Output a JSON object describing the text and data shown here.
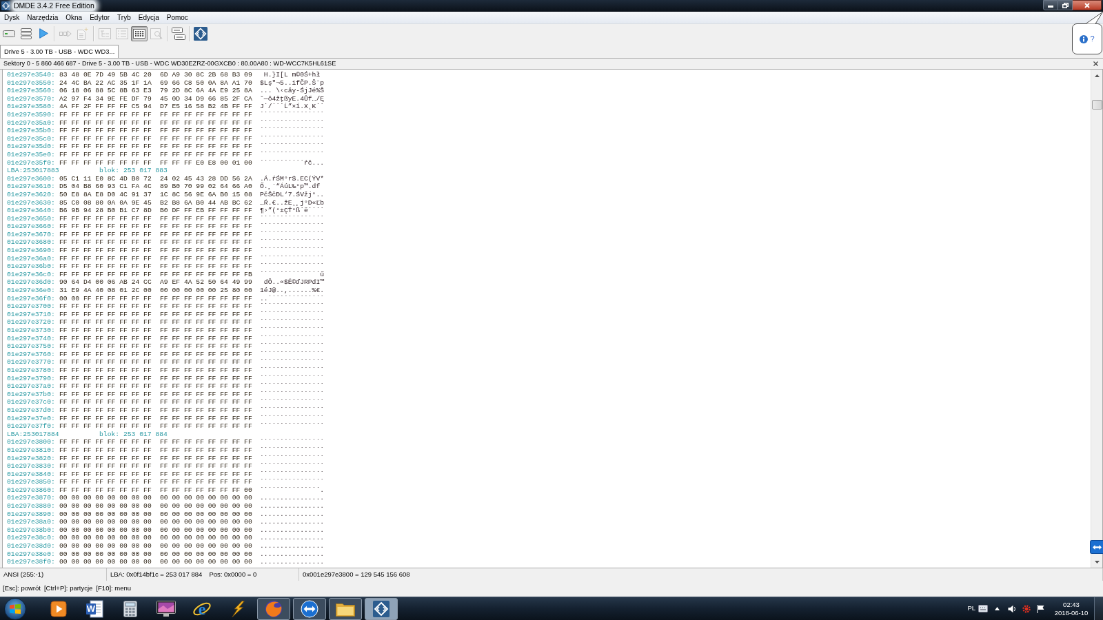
{
  "window": {
    "title": "DMDE 3.4.2 Free Edition"
  },
  "menu": [
    "Dysk",
    "Narzędzia",
    "Okna",
    "Edytor",
    "Tryb",
    "Edycja",
    "Pomoc"
  ],
  "toolbar": [
    [
      {
        "disabled": false,
        "pressed": false
      },
      {
        "disabled": false,
        "pressed": false
      },
      {
        "disabled": false,
        "pressed": false
      }
    ],
    [
      {
        "disabled": true,
        "pressed": false
      },
      {
        "disabled": true,
        "pressed": false
      }
    ],
    [
      {
        "disabled": true,
        "pressed": false
      },
      {
        "disabled": true,
        "pressed": false
      },
      {
        "disabled": false,
        "pressed": true
      },
      {
        "disabled": true,
        "pressed": false
      }
    ],
    [
      {
        "disabled": false,
        "pressed": false
      }
    ],
    [
      {
        "disabled": false,
        "pressed": false
      }
    ]
  ],
  "help": {
    "label": "?"
  },
  "tabs": [
    {
      "label": "Drive 5 - 3.00 TB - USB - WDC WD3...",
      "selected": true
    }
  ],
  "panel": {
    "title": "Sektory 0 - 5 860 466 687 - Drive 5 - 3.00 TB - USB - WDC WD30EZRZ-00GXCB0 : 80.00A80 : WD-WCC7K5HL61SE"
  },
  "hex_view": {
    "lines": [
      {
        "kind": "data",
        "offset": "01e297e3540:",
        "bytes": [
          "83 48 0E 7D 49 5B 4C 20",
          "6D A9 30 8C 2B 68 B3 09"
        ],
        "text": " H.}I[L m©0Ś+hł"
      },
      {
        "kind": "data",
        "offset": "01e297e3550:",
        "bytes": [
          "24 4C BA 22 AC 35 1F 1A",
          "69 66 C8 50 0A 8A A1 70"
        ],
        "text": "$Lş\"¬5..ifČP.Šˇp"
      },
      {
        "kind": "data",
        "offset": "01e297e3560:",
        "bytes": [
          "06 18 06 88 5C 8B 63 E3",
          "79 2D 8C 6A 4A E9 25 8A"
        ],
        "text": "... \\‹căy-ŚjJé%Š"
      },
      {
        "kind": "data",
        "offset": "01e297e3570:",
        "bytes": [
          "A2 97 F4 34 9E FE DF 79",
          "45 0D 34 D9 66 85 2F CA"
        ],
        "text": "˘—ô4žţßyE.4Ůf…/Ę"
      },
      {
        "kind": "data",
        "offset": "01e297e3580:",
        "bytes": [
          "4A FF 2F FF FF FF C5 94",
          "D7 E5 16 58 B2 4B FF FF"
        ],
        "text": "J˙/˙˙˙Ĺ”×ĺ.X˛K˙˙"
      },
      {
        "kind": "data",
        "offset": "01e297e3590:",
        "bytes": [
          "FF FF FF FF FF FF FF FF",
          "FF FF FF FF FF FF FF FF"
        ],
        "text": "˙˙˙˙˙˙˙˙˙˙˙˙˙˙˙˙"
      },
      {
        "kind": "data",
        "offset": "01e297e35a0:",
        "bytes": [
          "FF FF FF FF FF FF FF FF",
          "FF FF FF FF FF FF FF FF"
        ],
        "text": "˙˙˙˙˙˙˙˙˙˙˙˙˙˙˙˙"
      },
      {
        "kind": "data",
        "offset": "01e297e35b0:",
        "bytes": [
          "FF FF FF FF FF FF FF FF",
          "FF FF FF FF FF FF FF FF"
        ],
        "text": "˙˙˙˙˙˙˙˙˙˙˙˙˙˙˙˙"
      },
      {
        "kind": "data",
        "offset": "01e297e35c0:",
        "bytes": [
          "FF FF FF FF FF FF FF FF",
          "FF FF FF FF FF FF FF FF"
        ],
        "text": "˙˙˙˙˙˙˙˙˙˙˙˙˙˙˙˙"
      },
      {
        "kind": "data",
        "offset": "01e297e35d0:",
        "bytes": [
          "FF FF FF FF FF FF FF FF",
          "FF FF FF FF FF FF FF FF"
        ],
        "text": "˙˙˙˙˙˙˙˙˙˙˙˙˙˙˙˙"
      },
      {
        "kind": "data",
        "offset": "01e297e35e0:",
        "bytes": [
          "FF FF FF FF FF FF FF FF",
          "FF FF FF FF FF FF FF FF"
        ],
        "text": "˙˙˙˙˙˙˙˙˙˙˙˙˙˙˙˙"
      },
      {
        "kind": "data",
        "offset": "01e297e35f0:",
        "bytes": [
          "FF FF FF FF FF FF FF FF",
          "FF FF FF E0 E8 00 01 00"
        ],
        "text": "˙˙˙˙˙˙˙˙˙˙˙ŕč..."
      },
      {
        "kind": "sector",
        "lba": "LBA:253017883",
        "block": "blok: 253 017 883"
      },
      {
        "kind": "data",
        "offset": "01e297e3600:",
        "bytes": [
          "05 C1 11 E0 8C 4D B0 72",
          "24 02 45 43 28 DD 56 2A"
        ],
        "text": ".Á.ŕŚM°r$.EC(ÝV*"
      },
      {
        "kind": "data",
        "offset": "01e297e3610:",
        "bytes": [
          "D5 04 B8 60 93 C1 FA 4C",
          "89 B0 70 99 02 64 66 A0"
        ],
        "text": "Ő.¸`“ÁúL‰°p™.df"
      },
      {
        "kind": "data",
        "offset": "01e297e3620:",
        "bytes": [
          "50 E8 8A E8 D0 4C 91 37",
          "1C 8C 56 9E 6A B0 15 08"
        ],
        "text": "PčŠčĐL‘7.ŚVžj°.."
      },
      {
        "kind": "data",
        "offset": "01e297e3630:",
        "bytes": [
          "85 C0 08 80 0A 0A 9E 45",
          "B2 B8 6A B0 44 AB BC 62"
        ],
        "text": "…Ŕ.€..žE˛¸j°D«Ľb"
      },
      {
        "kind": "data",
        "offset": "01e297e3640:",
        "bytes": [
          "B6 9B 94 28 B0 B1 C7 8D",
          "B0 DF FF EB FF FF FF FF"
        ],
        "text": "¶›”(°±ÇŤ°ß˙ë˙˙˙˙"
      },
      {
        "kind": "data",
        "offset": "01e297e3650:",
        "bytes": [
          "FF FF FF FF FF FF FF FF",
          "FF FF FF FF FF FF FF FF"
        ],
        "text": "˙˙˙˙˙˙˙˙˙˙˙˙˙˙˙˙"
      },
      {
        "kind": "data",
        "offset": "01e297e3660:",
        "bytes": [
          "FF FF FF FF FF FF FF FF",
          "FF FF FF FF FF FF FF FF"
        ],
        "text": "˙˙˙˙˙˙˙˙˙˙˙˙˙˙˙˙"
      },
      {
        "kind": "data",
        "offset": "01e297e3670:",
        "bytes": [
          "FF FF FF FF FF FF FF FF",
          "FF FF FF FF FF FF FF FF"
        ],
        "text": "˙˙˙˙˙˙˙˙˙˙˙˙˙˙˙˙"
      },
      {
        "kind": "data",
        "offset": "01e297e3680:",
        "bytes": [
          "FF FF FF FF FF FF FF FF",
          "FF FF FF FF FF FF FF FF"
        ],
        "text": "˙˙˙˙˙˙˙˙˙˙˙˙˙˙˙˙"
      },
      {
        "kind": "data",
        "offset": "01e297e3690:",
        "bytes": [
          "FF FF FF FF FF FF FF FF",
          "FF FF FF FF FF FF FF FF"
        ],
        "text": "˙˙˙˙˙˙˙˙˙˙˙˙˙˙˙˙"
      },
      {
        "kind": "data",
        "offset": "01e297e36a0:",
        "bytes": [
          "FF FF FF FF FF FF FF FF",
          "FF FF FF FF FF FF FF FF"
        ],
        "text": "˙˙˙˙˙˙˙˙˙˙˙˙˙˙˙˙"
      },
      {
        "kind": "data",
        "offset": "01e297e36b0:",
        "bytes": [
          "FF FF FF FF FF FF FF FF",
          "FF FF FF FF FF FF FF FF"
        ],
        "text": "˙˙˙˙˙˙˙˙˙˙˙˙˙˙˙˙"
      },
      {
        "kind": "data",
        "offset": "01e297e36c0:",
        "bytes": [
          "FF FF FF FF FF FF FF FF",
          "FF FF FF FF FF FF FF FB"
        ],
        "text": "˙˙˙˙˙˙˙˙˙˙˙˙˙˙˙ű"
      },
      {
        "kind": "data",
        "offset": "01e297e36d0:",
        "bytes": [
          "90 64 D4 00 06 AB 24 CC",
          "A9 EF 4A 52 50 64 49 99"
        ],
        "text": " dÔ..«$Ě©ďJRPdI™"
      },
      {
        "kind": "data",
        "offset": "01e297e36e0:",
        "bytes": [
          "31 E9 4A 40 08 01 2C 00",
          "00 00 00 00 00 25 80 00"
        ],
        "text": "1éJ@..,......%€."
      },
      {
        "kind": "data",
        "offset": "01e297e36f0:",
        "bytes": [
          "00 00 FF FF FF FF FF FF",
          "FF FF FF FF FF FF FF FF"
        ],
        "text": "..˙˙˙˙˙˙˙˙˙˙˙˙˙˙"
      },
      {
        "kind": "data",
        "offset": "01e297e3700:",
        "bytes": [
          "FF FF FF FF FF FF FF FF",
          "FF FF FF FF FF FF FF FF"
        ],
        "text": "˙˙˙˙˙˙˙˙˙˙˙˙˙˙˙˙"
      },
      {
        "kind": "data",
        "offset": "01e297e3710:",
        "bytes": [
          "FF FF FF FF FF FF FF FF",
          "FF FF FF FF FF FF FF FF"
        ],
        "text": "˙˙˙˙˙˙˙˙˙˙˙˙˙˙˙˙"
      },
      {
        "kind": "data",
        "offset": "01e297e3720:",
        "bytes": [
          "FF FF FF FF FF FF FF FF",
          "FF FF FF FF FF FF FF FF"
        ],
        "text": "˙˙˙˙˙˙˙˙˙˙˙˙˙˙˙˙"
      },
      {
        "kind": "data",
        "offset": "01e297e3730:",
        "bytes": [
          "FF FF FF FF FF FF FF FF",
          "FF FF FF FF FF FF FF FF"
        ],
        "text": "˙˙˙˙˙˙˙˙˙˙˙˙˙˙˙˙"
      },
      {
        "kind": "data",
        "offset": "01e297e3740:",
        "bytes": [
          "FF FF FF FF FF FF FF FF",
          "FF FF FF FF FF FF FF FF"
        ],
        "text": "˙˙˙˙˙˙˙˙˙˙˙˙˙˙˙˙"
      },
      {
        "kind": "data",
        "offset": "01e297e3750:",
        "bytes": [
          "FF FF FF FF FF FF FF FF",
          "FF FF FF FF FF FF FF FF"
        ],
        "text": "˙˙˙˙˙˙˙˙˙˙˙˙˙˙˙˙"
      },
      {
        "kind": "data",
        "offset": "01e297e3760:",
        "bytes": [
          "FF FF FF FF FF FF FF FF",
          "FF FF FF FF FF FF FF FF"
        ],
        "text": "˙˙˙˙˙˙˙˙˙˙˙˙˙˙˙˙"
      },
      {
        "kind": "data",
        "offset": "01e297e3770:",
        "bytes": [
          "FF FF FF FF FF FF FF FF",
          "FF FF FF FF FF FF FF FF"
        ],
        "text": "˙˙˙˙˙˙˙˙˙˙˙˙˙˙˙˙"
      },
      {
        "kind": "data",
        "offset": "01e297e3780:",
        "bytes": [
          "FF FF FF FF FF FF FF FF",
          "FF FF FF FF FF FF FF FF"
        ],
        "text": "˙˙˙˙˙˙˙˙˙˙˙˙˙˙˙˙"
      },
      {
        "kind": "data",
        "offset": "01e297e3790:",
        "bytes": [
          "FF FF FF FF FF FF FF FF",
          "FF FF FF FF FF FF FF FF"
        ],
        "text": "˙˙˙˙˙˙˙˙˙˙˙˙˙˙˙˙"
      },
      {
        "kind": "data",
        "offset": "01e297e37a0:",
        "bytes": [
          "FF FF FF FF FF FF FF FF",
          "FF FF FF FF FF FF FF FF"
        ],
        "text": "˙˙˙˙˙˙˙˙˙˙˙˙˙˙˙˙"
      },
      {
        "kind": "data",
        "offset": "01e297e37b0:",
        "bytes": [
          "FF FF FF FF FF FF FF FF",
          "FF FF FF FF FF FF FF FF"
        ],
        "text": "˙˙˙˙˙˙˙˙˙˙˙˙˙˙˙˙"
      },
      {
        "kind": "data",
        "offset": "01e297e37c0:",
        "bytes": [
          "FF FF FF FF FF FF FF FF",
          "FF FF FF FF FF FF FF FF"
        ],
        "text": "˙˙˙˙˙˙˙˙˙˙˙˙˙˙˙˙"
      },
      {
        "kind": "data",
        "offset": "01e297e37d0:",
        "bytes": [
          "FF FF FF FF FF FF FF FF",
          "FF FF FF FF FF FF FF FF"
        ],
        "text": "˙˙˙˙˙˙˙˙˙˙˙˙˙˙˙˙"
      },
      {
        "kind": "data",
        "offset": "01e297e37e0:",
        "bytes": [
          "FF FF FF FF FF FF FF FF",
          "FF FF FF FF FF FF FF FF"
        ],
        "text": "˙˙˙˙˙˙˙˙˙˙˙˙˙˙˙˙"
      },
      {
        "kind": "data",
        "offset": "01e297e37f0:",
        "bytes": [
          "FF FF FF FF FF FF FF FF",
          "FF FF FF FF FF FF FF FF"
        ],
        "text": "˙˙˙˙˙˙˙˙˙˙˙˙˙˙˙˙"
      },
      {
        "kind": "sector",
        "lba": "LBA:253017884",
        "block": "blok: 253 017 884"
      },
      {
        "kind": "data",
        "offset": "01e297e3800:",
        "bytes": [
          "FF FF FF FF FF FF FF FF",
          "FF FF FF FF FF FF FF FF"
        ],
        "text": "˙˙˙˙˙˙˙˙˙˙˙˙˙˙˙˙"
      },
      {
        "kind": "data",
        "offset": "01e297e3810:",
        "bytes": [
          "FF FF FF FF FF FF FF FF",
          "FF FF FF FF FF FF FF FF"
        ],
        "text": "˙˙˙˙˙˙˙˙˙˙˙˙˙˙˙˙"
      },
      {
        "kind": "data",
        "offset": "01e297e3820:",
        "bytes": [
          "FF FF FF FF FF FF FF FF",
          "FF FF FF FF FF FF FF FF"
        ],
        "text": "˙˙˙˙˙˙˙˙˙˙˙˙˙˙˙˙"
      },
      {
        "kind": "data",
        "offset": "01e297e3830:",
        "bytes": [
          "FF FF FF FF FF FF FF FF",
          "FF FF FF FF FF FF FF FF"
        ],
        "text": "˙˙˙˙˙˙˙˙˙˙˙˙˙˙˙˙"
      },
      {
        "kind": "data",
        "offset": "01e297e3840:",
        "bytes": [
          "FF FF FF FF FF FF FF FF",
          "FF FF FF FF FF FF FF FF"
        ],
        "text": "˙˙˙˙˙˙˙˙˙˙˙˙˙˙˙˙"
      },
      {
        "kind": "data",
        "offset": "01e297e3850:",
        "bytes": [
          "FF FF FF FF FF FF FF FF",
          "FF FF FF FF FF FF FF FF"
        ],
        "text": "˙˙˙˙˙˙˙˙˙˙˙˙˙˙˙˙"
      },
      {
        "kind": "data",
        "offset": "01e297e3860:",
        "bytes": [
          "FF FF FF FF FF FF FF FF",
          "FF FF FF FF FF FF FF 00"
        ],
        "text": "˙˙˙˙˙˙˙˙˙˙˙˙˙˙˙."
      },
      {
        "kind": "data",
        "offset": "01e297e3870:",
        "bytes": [
          "00 00 00 00 00 00 00 00",
          "00 00 00 00 00 00 00 00"
        ],
        "text": "................"
      },
      {
        "kind": "data",
        "offset": "01e297e3880:",
        "bytes": [
          "00 00 00 00 00 00 00 00",
          "00 00 00 00 00 00 00 00"
        ],
        "text": "................"
      },
      {
        "kind": "data",
        "offset": "01e297e3890:",
        "bytes": [
          "00 00 00 00 00 00 00 00",
          "00 00 00 00 00 00 00 00"
        ],
        "text": "................"
      },
      {
        "kind": "data",
        "offset": "01e297e38a0:",
        "bytes": [
          "00 00 00 00 00 00 00 00",
          "00 00 00 00 00 00 00 00"
        ],
        "text": "................"
      },
      {
        "kind": "data",
        "offset": "01e297e38b0:",
        "bytes": [
          "00 00 00 00 00 00 00 00",
          "00 00 00 00 00 00 00 00"
        ],
        "text": "................"
      },
      {
        "kind": "data",
        "offset": "01e297e38c0:",
        "bytes": [
          "00 00 00 00 00 00 00 00",
          "00 00 00 00 00 00 00 00"
        ],
        "text": "................"
      },
      {
        "kind": "data",
        "offset": "01e297e38d0:",
        "bytes": [
          "00 00 00 00 00 00 00 00",
          "00 00 00 00 00 00 00 00"
        ],
        "text": "................"
      },
      {
        "kind": "data",
        "offset": "01e297e38e0:",
        "bytes": [
          "00 00 00 00 00 00 00 00",
          "00 00 00 00 00 00 00 00"
        ],
        "text": "................"
      },
      {
        "kind": "data",
        "offset": "01e297e38f0:",
        "bytes": [
          "00 00 00 00 00 00 00 00",
          "00 00 00 00 00 00 00 00"
        ],
        "text": "................"
      }
    ]
  },
  "status_bar": [
    [
      "ANSI (255:-1)"
    ],
    [
      "LBA: 0x0f14bf1c = 253 017 884",
      "Pos: 0x0000 = 0"
    ],
    [
      "0x001e297e3800 = 129 545 156 608"
    ]
  ],
  "key_hints": [
    "[Esc]: powrót",
    "[Ctrl+P]: partycje",
    "[F10]: menu"
  ],
  "taskbar": {
    "apps": [
      {
        "running": false,
        "selected": false
      },
      {
        "running": false,
        "selected": false,
        "logo_text": "W"
      },
      {
        "running": false,
        "selected": false
      },
      {
        "running": false,
        "selected": false
      },
      {
        "running": false,
        "selected": false,
        "logo_text": "e"
      },
      {
        "running": false,
        "selected": false
      },
      {
        "running": true,
        "selected": false
      },
      {
        "running": true,
        "selected": false
      },
      {
        "running": true,
        "selected": false
      },
      {
        "running": true,
        "selected": true
      }
    ],
    "tray": {
      "language": "PL",
      "time": "02:43",
      "date": "2018-06-10"
    }
  }
}
